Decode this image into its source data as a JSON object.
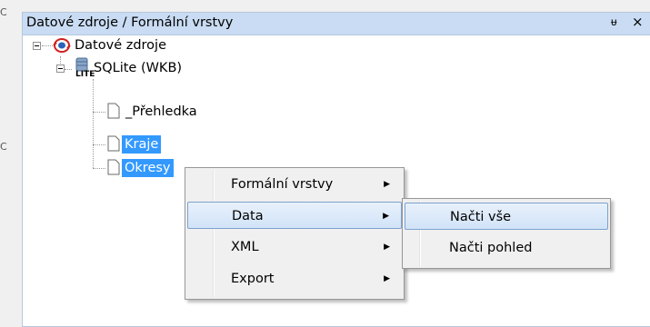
{
  "panel": {
    "title": "Datové zdroje / Formální vrstvy",
    "pin_glyph": "ᵾ",
    "close_glyph": "×"
  },
  "tree": {
    "root": {
      "label": "Datové zdroje",
      "icon": "datasource-globe-icon"
    },
    "db": {
      "label": "SQLite (WKB)",
      "icon": "sqlite-database-icon",
      "icon_caption": "LITE"
    },
    "items": [
      {
        "label": "_Přehledka",
        "selected": false
      },
      {
        "label": "Kraje",
        "selected": true
      },
      {
        "label": "Okresy",
        "selected": true
      }
    ]
  },
  "context_menu": {
    "items": [
      {
        "label": "Formální vrstvy",
        "submenu": true,
        "highlighted": false
      },
      {
        "label": "Data",
        "submenu": true,
        "highlighted": true
      },
      {
        "label": "XML",
        "submenu": true,
        "highlighted": false
      },
      {
        "label": "Export",
        "submenu": true,
        "highlighted": false
      }
    ],
    "arrow_glyph": "▶"
  },
  "submenu": {
    "items": [
      {
        "label": "Načti vše",
        "highlighted": true
      },
      {
        "label": "Načti pohled",
        "highlighted": false
      }
    ]
  },
  "edge_stubs": [
    "C",
    "C"
  ]
}
